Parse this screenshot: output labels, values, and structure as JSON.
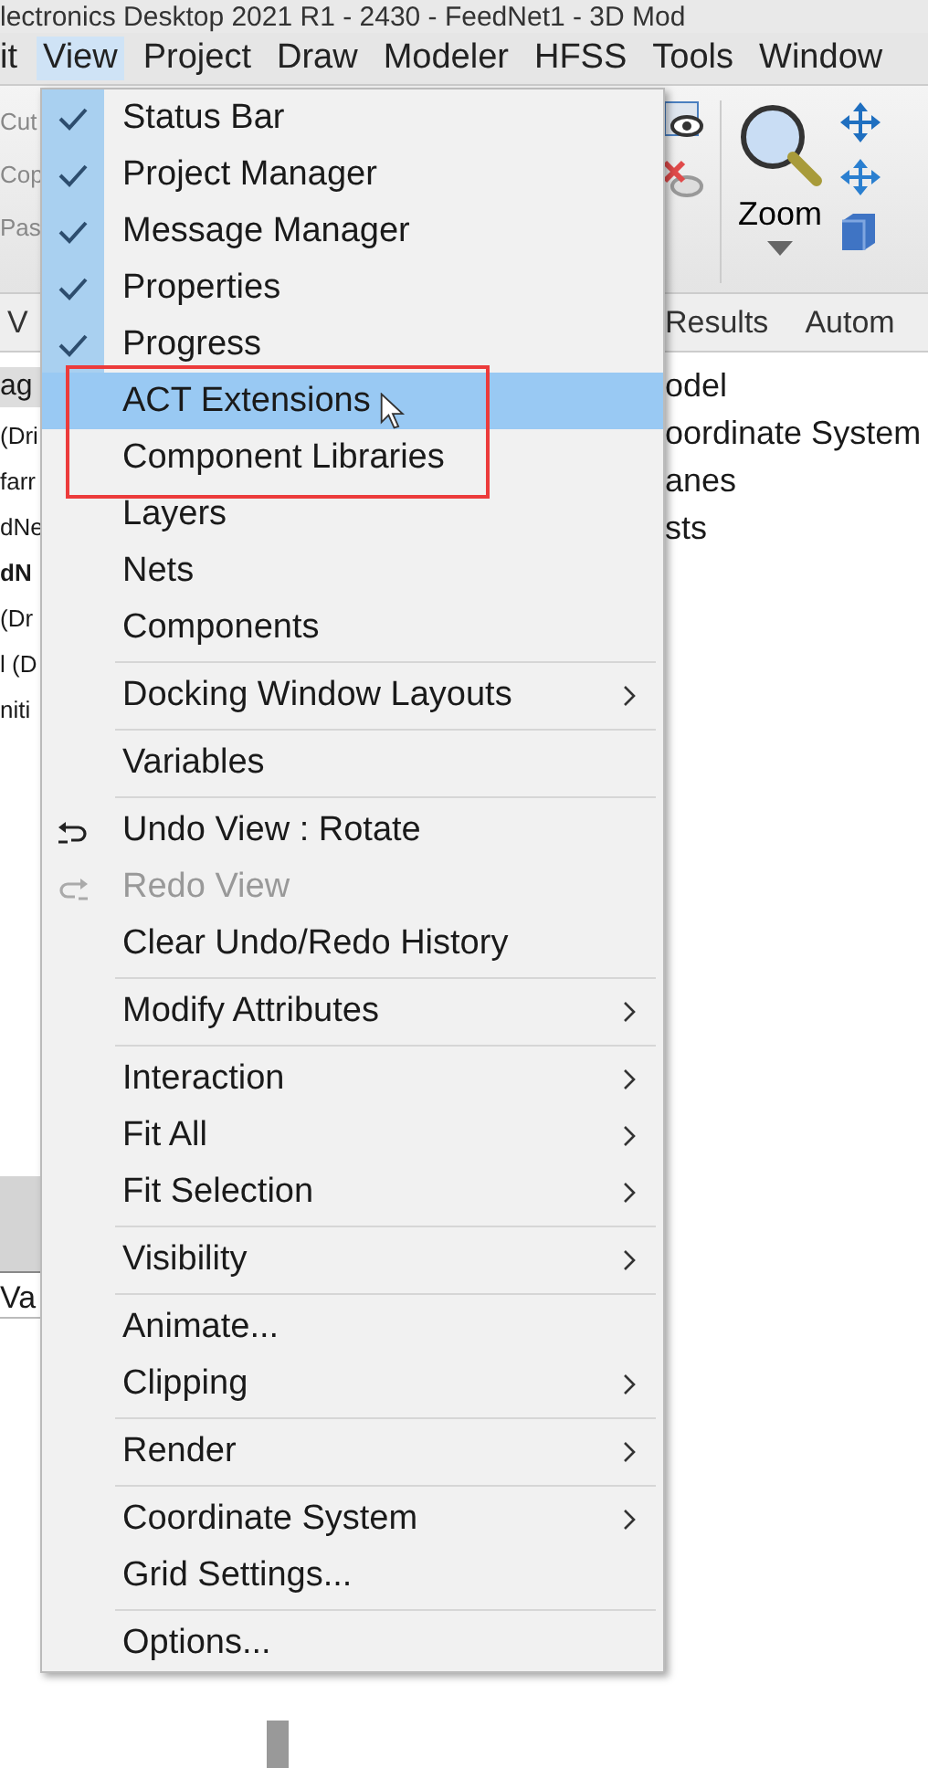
{
  "window": {
    "title": "lectronics Desktop 2021 R1 - 2430 - FeedNet1 - 3D Mod"
  },
  "menubar": [
    {
      "label": "it",
      "selected": false
    },
    {
      "label": "View",
      "selected": true
    },
    {
      "label": "Project",
      "selected": false
    },
    {
      "label": "Draw",
      "selected": false
    },
    {
      "label": "Modeler",
      "selected": false
    },
    {
      "label": "HFSS",
      "selected": false
    },
    {
      "label": "Tools",
      "selected": false
    },
    {
      "label": "Window",
      "selected": false
    }
  ],
  "toolbar": {
    "clipboard": [
      {
        "label": "Cut",
        "disabled": true
      },
      {
        "label": "Cop",
        "disabled": true
      },
      {
        "label": "Pas",
        "disabled": true
      }
    ],
    "zoom": {
      "label": "Zoom"
    }
  },
  "tabs": [
    {
      "label": "V",
      "selected": false
    },
    {
      "label": "Results",
      "selected": false
    },
    {
      "label": "Autom",
      "selected": false
    }
  ],
  "left_panel": {
    "header": "ag",
    "rows": [
      {
        "text": "(Dri",
        "bold": false
      },
      {
        "text": "farr",
        "bold": false
      },
      {
        "text": "dNe",
        "bold": false
      },
      {
        "text": "dN",
        "bold": true
      },
      {
        "text": "(Dr",
        "bold": false
      },
      {
        "text": "l (D",
        "bold": false
      },
      {
        "text": "niti",
        "bold": false
      }
    ],
    "bottom_header": "Va"
  },
  "right_panel": {
    "rows": [
      "odel",
      "oordinate System",
      "anes",
      "sts"
    ]
  },
  "view_menu": {
    "groups": [
      [
        {
          "label": "Status Bar",
          "checked": true,
          "selected": false,
          "disabled": false,
          "submenu": false
        },
        {
          "label": "Project Manager",
          "checked": true,
          "selected": false,
          "disabled": false,
          "submenu": false
        },
        {
          "label": "Message Manager",
          "checked": true,
          "selected": false,
          "disabled": false,
          "submenu": false
        },
        {
          "label": "Properties",
          "checked": true,
          "selected": false,
          "disabled": false,
          "submenu": false
        },
        {
          "label": "Progress",
          "checked": true,
          "selected": false,
          "disabled": false,
          "submenu": false
        },
        {
          "label": "ACT Extensions",
          "checked": false,
          "selected": true,
          "disabled": false,
          "submenu": false
        },
        {
          "label": "Component Libraries",
          "checked": false,
          "selected": false,
          "disabled": false,
          "submenu": false
        },
        {
          "label": "Layers",
          "checked": false,
          "selected": false,
          "disabled": false,
          "submenu": false
        },
        {
          "label": "Nets",
          "checked": false,
          "selected": false,
          "disabled": false,
          "submenu": false
        },
        {
          "label": "Components",
          "checked": false,
          "selected": false,
          "disabled": false,
          "submenu": false
        }
      ],
      [
        {
          "label": "Docking Window Layouts",
          "checked": false,
          "selected": false,
          "disabled": false,
          "submenu": true
        }
      ],
      [
        {
          "label": "Variables",
          "checked": false,
          "selected": false,
          "disabled": false,
          "submenu": false
        }
      ],
      [
        {
          "label": "Undo View : Rotate",
          "checked": false,
          "selected": false,
          "disabled": false,
          "submenu": false,
          "kind": "undo"
        },
        {
          "label": "Redo View",
          "checked": false,
          "selected": false,
          "disabled": true,
          "submenu": false,
          "kind": "redo"
        },
        {
          "label": "Clear Undo/Redo History",
          "checked": false,
          "selected": false,
          "disabled": false,
          "submenu": false
        }
      ],
      [
        {
          "label": "Modify Attributes",
          "checked": false,
          "selected": false,
          "disabled": false,
          "submenu": true
        }
      ],
      [
        {
          "label": "Interaction",
          "checked": false,
          "selected": false,
          "disabled": false,
          "submenu": true
        },
        {
          "label": "Fit All",
          "checked": false,
          "selected": false,
          "disabled": false,
          "submenu": true
        },
        {
          "label": "Fit Selection",
          "checked": false,
          "selected": false,
          "disabled": false,
          "submenu": true
        }
      ],
      [
        {
          "label": "Visibility",
          "checked": false,
          "selected": false,
          "disabled": false,
          "submenu": true
        }
      ],
      [
        {
          "label": "Animate...",
          "checked": false,
          "selected": false,
          "disabled": false,
          "submenu": false
        },
        {
          "label": "Clipping",
          "checked": false,
          "selected": false,
          "disabled": false,
          "submenu": true
        }
      ],
      [
        {
          "label": "Render",
          "checked": false,
          "selected": false,
          "disabled": false,
          "submenu": true
        }
      ],
      [
        {
          "label": "Coordinate System",
          "checked": false,
          "selected": false,
          "disabled": false,
          "submenu": true
        },
        {
          "label": "Grid Settings...",
          "checked": false,
          "selected": false,
          "disabled": false,
          "submenu": false
        }
      ],
      [
        {
          "label": "Options...",
          "checked": false,
          "selected": false,
          "disabled": false,
          "submenu": false
        }
      ]
    ]
  }
}
